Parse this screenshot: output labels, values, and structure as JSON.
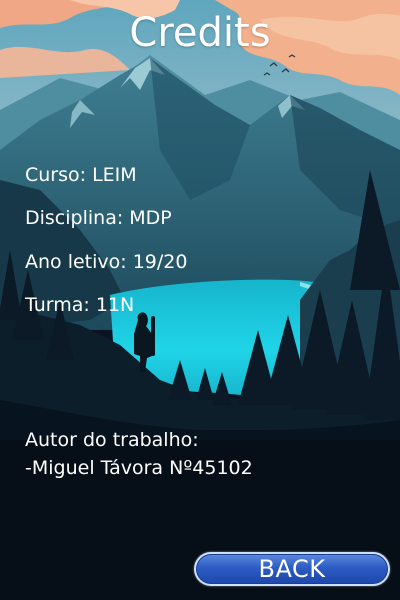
{
  "screen": {
    "title": "Credits",
    "details": [
      {
        "label": "Curso: LEIM"
      },
      {
        "label": "Disciplina: MDP"
      },
      {
        "label": "Ano letivo: 19/20"
      },
      {
        "label": "Turma: 11N"
      }
    ],
    "author": {
      "heading": "Autor do trabalho:",
      "name": "-Miguel Távora Nº45102"
    },
    "back_label": "BACK"
  },
  "colors": {
    "text": "#ffffff",
    "button": "#2c5cc4",
    "lake": "#1fd2e6",
    "sky_peach": "#f0a07c"
  },
  "background": "mountain-lake-landscape-illustration"
}
